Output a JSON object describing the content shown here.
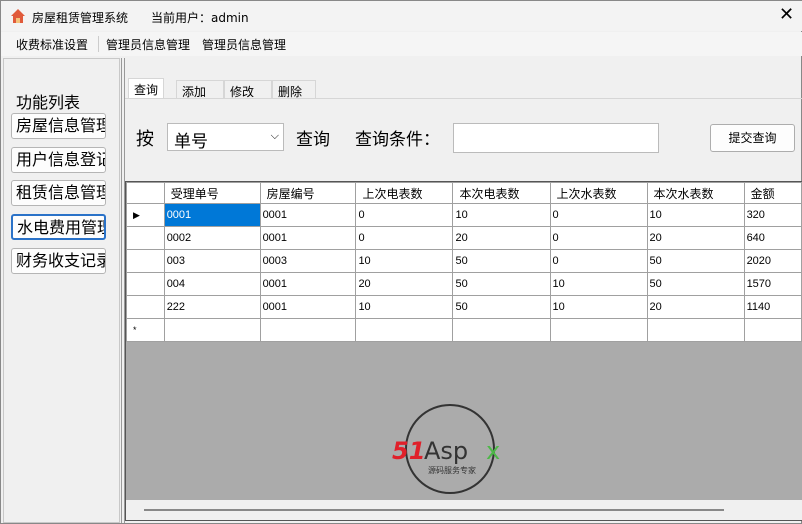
{
  "window": {
    "title": "房屋租赁管理系统",
    "user_label": "当前用户：admin",
    "close_icon": "close-icon",
    "app_icon": "house-icon"
  },
  "menu": [
    "收费标准设置",
    "管理员信息管理",
    "管理员信息管理"
  ],
  "sidebar": {
    "title": "功能列表",
    "items": [
      "房屋信息管理",
      "用户信息登记",
      "租赁信息管理",
      "水电费用管理",
      "财务收支记录"
    ]
  },
  "tabs": [
    "查询",
    "添加",
    "修改",
    "删除"
  ],
  "search": {
    "by_label": "按",
    "field_value": "单号",
    "query_label": "查询",
    "condition_label": "查询条件：",
    "condition_value": "",
    "submit": "提交查询"
  },
  "grid": {
    "columns": [
      "受理单号",
      "房屋编号",
      "上次电表数",
      "本次电表数",
      "上次水表数",
      "本次水表数",
      "金额"
    ],
    "rows": [
      [
        "0001",
        "0001",
        "0",
        "10",
        "0",
        "10",
        "320"
      ],
      [
        "0002",
        "0001",
        "0",
        "20",
        "0",
        "20",
        "640"
      ],
      [
        "003",
        "0003",
        "10",
        "50",
        "0",
        "50",
        "2020"
      ],
      [
        "004",
        "0001",
        "20",
        "50",
        "10",
        "50",
        "1570"
      ],
      [
        "222",
        "0001",
        "10",
        "50",
        "10",
        "20",
        "1140"
      ]
    ]
  },
  "watermark": {
    "brand": "51Aspx",
    "tagline": "源码服务专家"
  }
}
